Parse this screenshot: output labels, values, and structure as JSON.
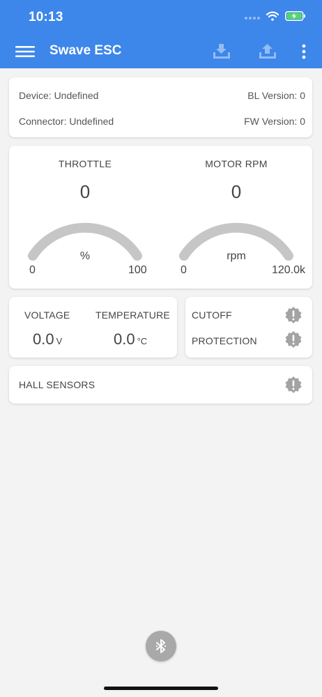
{
  "status_bar": {
    "time": "10:13"
  },
  "toolbar": {
    "title": "Swave ESC",
    "menu_icon": "hamburger-menu-icon",
    "download_icon": "download-icon",
    "upload_icon": "upload-icon",
    "more_icon": "more-vertical-icon"
  },
  "device_info": {
    "device": "Device: Undefined",
    "bl_version": "BL Version: 0",
    "connector": "Connector: Undefined",
    "fw_version": "FW Version: 0"
  },
  "gauges": {
    "throttle": {
      "label": "THROTTLE",
      "value": "0",
      "unit": "%",
      "min": "0",
      "max": "100"
    },
    "rpm": {
      "label": "MOTOR RPM",
      "value": "0",
      "unit": "rpm",
      "min": "0",
      "max": "120.0k"
    }
  },
  "readings": {
    "voltage_label": "VOLTAGE",
    "voltage_value": "0.0",
    "voltage_unit": "V",
    "temperature_label": "TEMPERATURE",
    "temperature_value": "0.0",
    "temperature_unit": "°C"
  },
  "status": {
    "cutoff": "CUTOFF",
    "protection": "PROTECTION",
    "hall_sensors": "HALL SENSORS"
  },
  "colors": {
    "header": "#3d86ea",
    "gauge_track": "#c6c6c6",
    "alert_icon": "#a3a3a3",
    "fab": "#a9a9a9"
  },
  "fab": {
    "icon": "bluetooth-icon"
  }
}
